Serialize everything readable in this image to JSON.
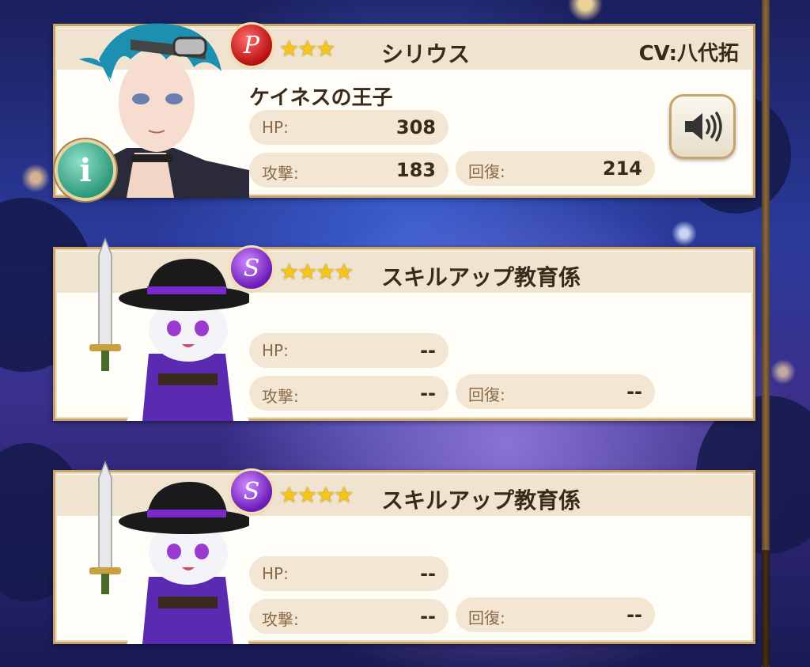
{
  "cards": [
    {
      "name": "シリウス",
      "subtitle": "ケイネスの王子",
      "cv": "CV:八代拓",
      "rarity_letter": "P",
      "stars": "★★★",
      "hp_label": "HP:",
      "hp": "308",
      "atk_label": "攻撃:",
      "atk": "183",
      "heal_label": "回復:",
      "heal": "214",
      "info_glyph": "i"
    },
    {
      "name": "スキルアップ教育係",
      "rarity_letter": "S",
      "stars": "★★★★",
      "hp_label": "HP:",
      "hp": "--",
      "atk_label": "攻撃:",
      "atk": "--",
      "heal_label": "回復:",
      "heal": "--"
    },
    {
      "name": "スキルアップ教育係",
      "rarity_letter": "S",
      "stars": "★★★★",
      "hp_label": "HP:",
      "hp": "--",
      "atk_label": "攻撃:",
      "atk": "--",
      "heal_label": "回復:",
      "heal": "--"
    }
  ],
  "icons": {
    "voice": "speaker-volume-icon",
    "info": "info-icon"
  },
  "colors": {
    "card_border": "#c9a46a",
    "header_bg": "#f0e4d0",
    "stat_bg": "#f3e6d3",
    "rarity_p": "#c41a1a",
    "rarity_s": "#7a22c8",
    "star": "#f5c518"
  }
}
